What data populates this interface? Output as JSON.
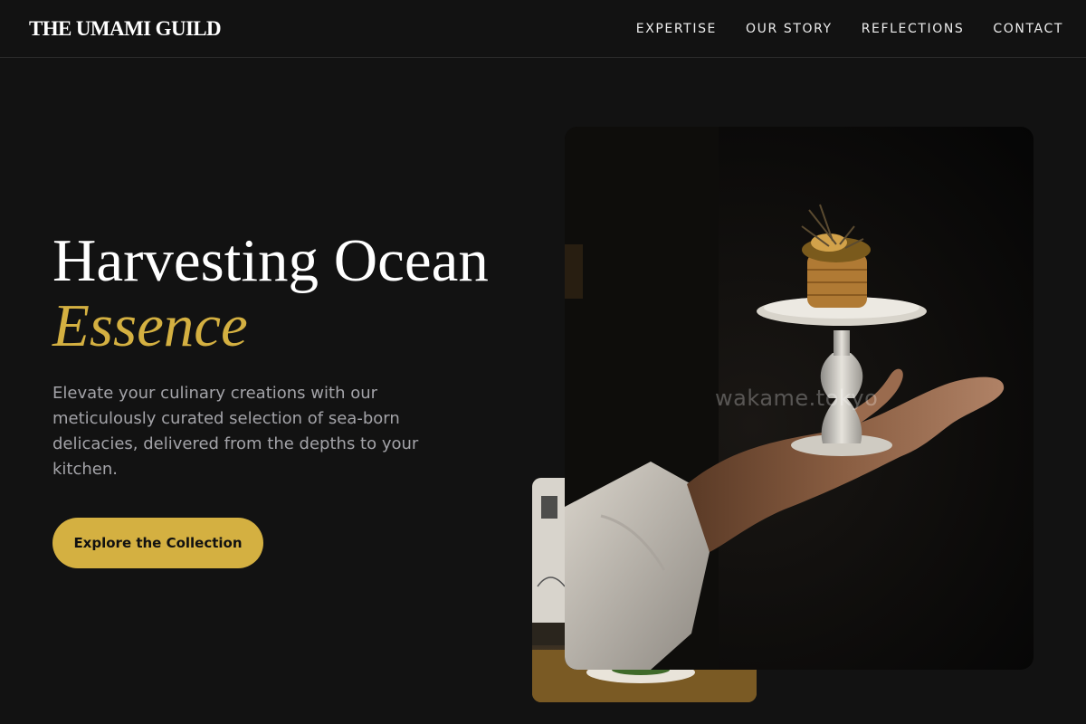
{
  "header": {
    "logo": "THE UMAMI GUILD",
    "nav": [
      "EXPERTISE",
      "OUR STORY",
      "REFLECTIONS",
      "CONTACT"
    ]
  },
  "hero": {
    "title_line1": "Harvesting Ocean",
    "title_accent": "Essence",
    "description": "Elevate your culinary creations with our meticulously curated selection of sea-born delicacies, delivered from the depths to your kitchen.",
    "cta_label": "Explore the Collection"
  },
  "photo_main": {
    "watermark": "wakame.tokyo",
    "subject": "hand-holding-pedestal-dish"
  },
  "photo_back": {
    "subject": "restaurant-menu-and-dish"
  },
  "colors": {
    "background": "#121212",
    "accent": "#d4b041",
    "text": "#ffffff",
    "muted": "#a3a3a8"
  }
}
